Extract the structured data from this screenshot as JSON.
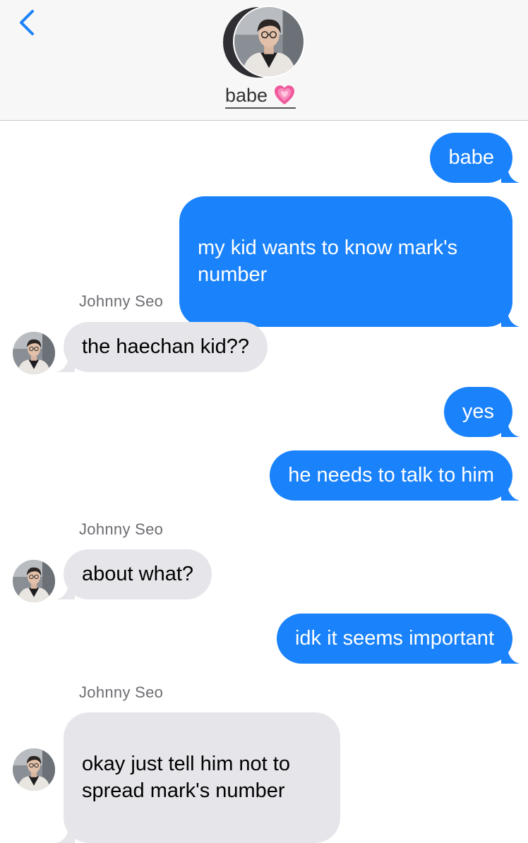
{
  "header": {
    "contact_name": "babe",
    "back_icon": "chevron-left-icon",
    "heart_icon": "growing-heart-emoji",
    "accent": "#1a82fb"
  },
  "messages": [
    {
      "direction": "sent",
      "text": "babe"
    },
    {
      "direction": "sent",
      "text": "my kid wants to know mark's\nnumber"
    },
    {
      "direction": "received",
      "sender": "Johnny Seo",
      "text": "the haechan kid??"
    },
    {
      "direction": "sent",
      "text": "yes"
    },
    {
      "direction": "sent",
      "text": "he needs to talk to him"
    },
    {
      "direction": "received",
      "sender": "Johnny Seo",
      "text": "about what?"
    },
    {
      "direction": "sent",
      "text": "idk it seems important"
    },
    {
      "direction": "received",
      "sender": "Johnny Seo",
      "text": "okay just tell him not to\nspread mark's number"
    }
  ]
}
